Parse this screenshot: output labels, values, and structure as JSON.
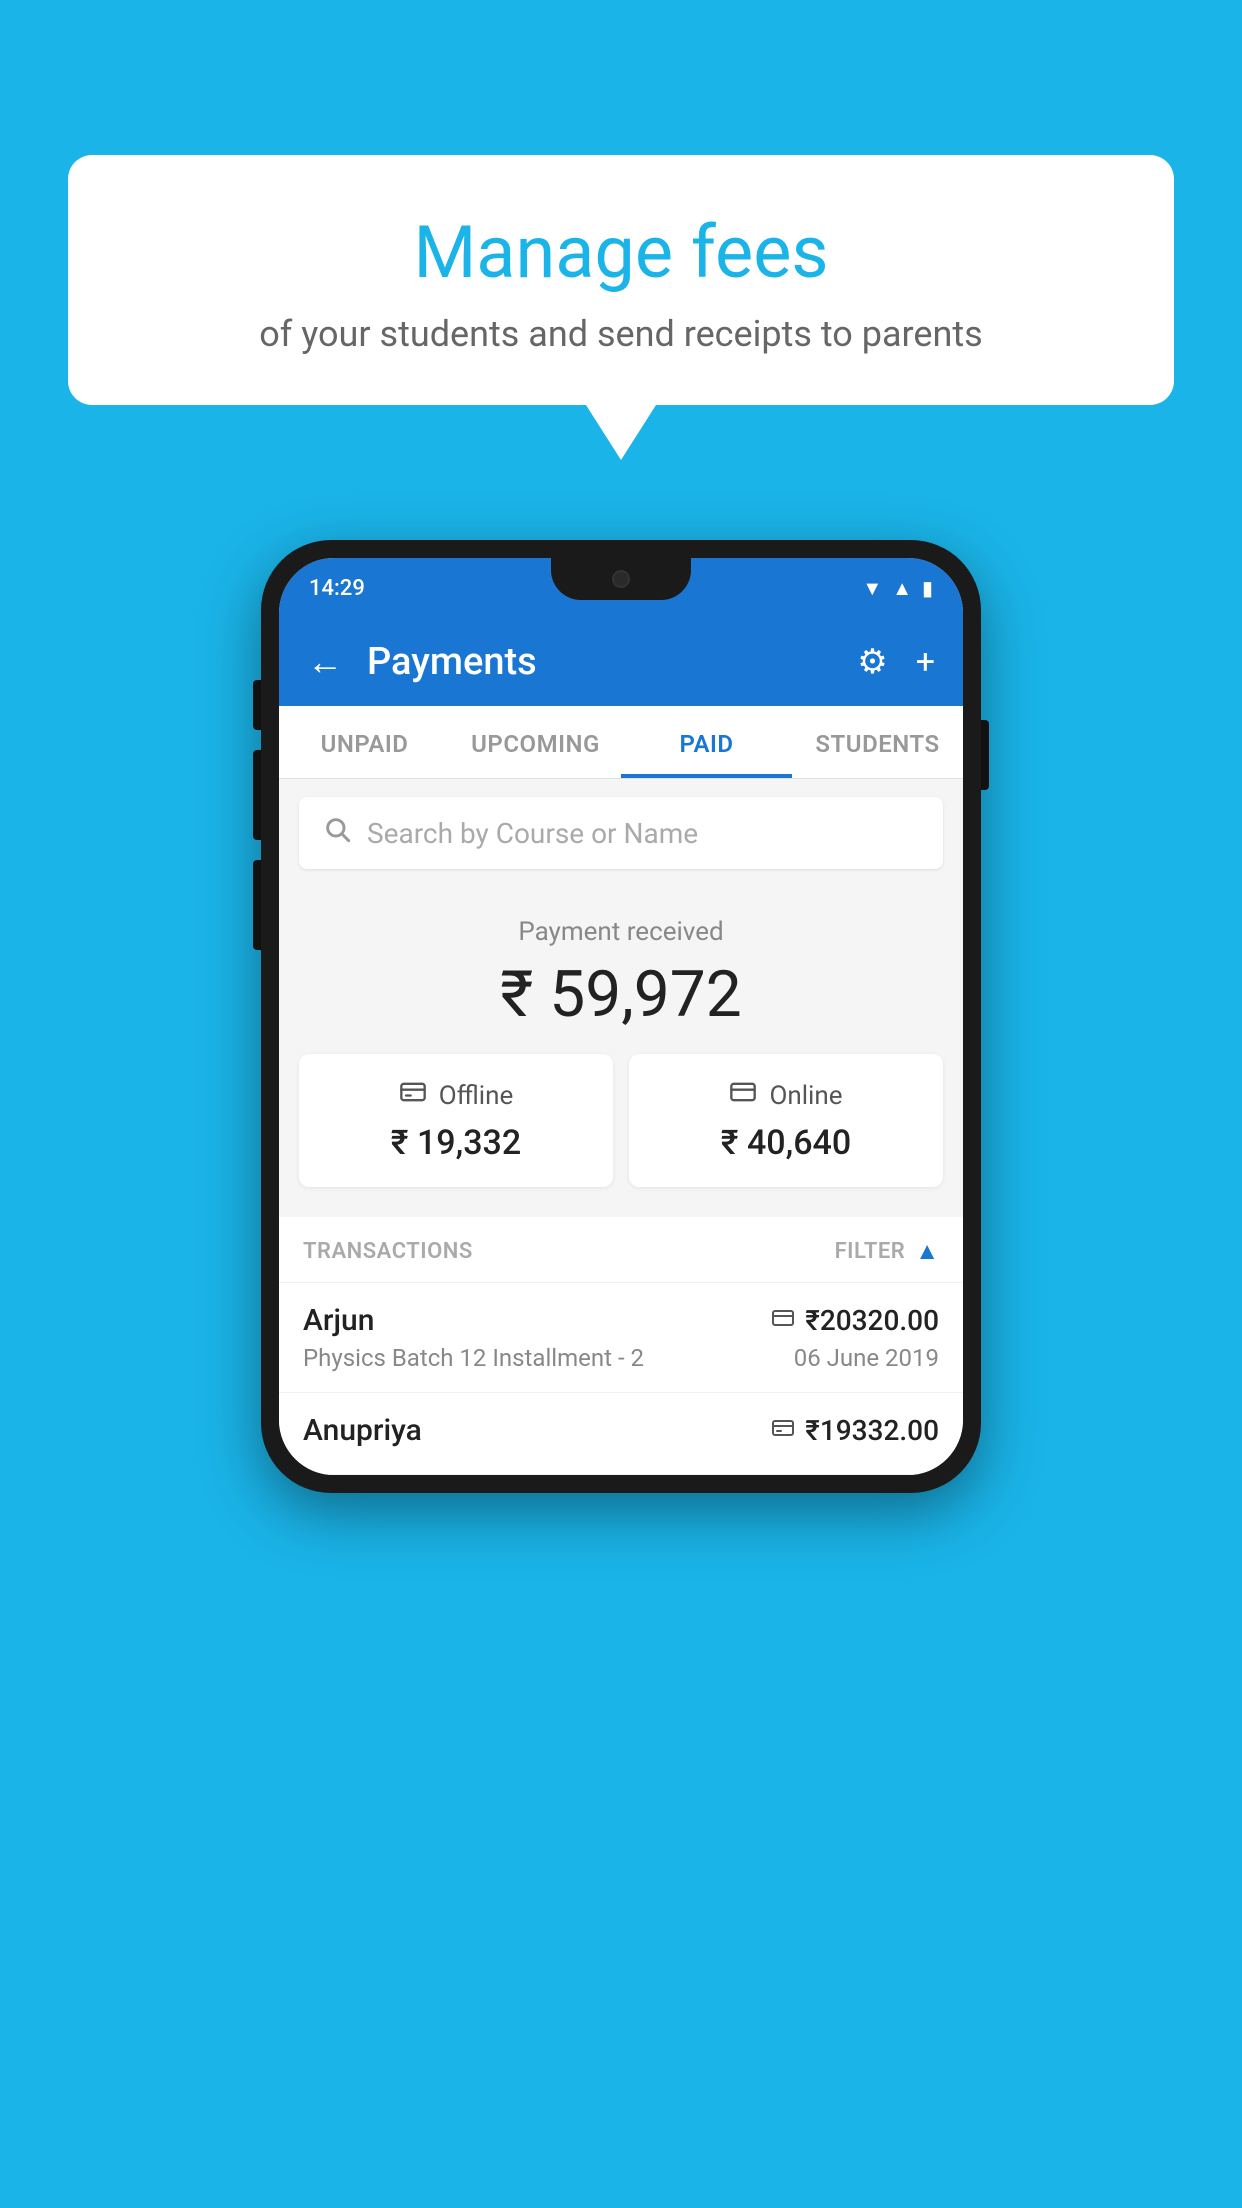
{
  "page": {
    "background_color": "#1ab4e8"
  },
  "speech_bubble": {
    "title": "Manage fees",
    "subtitle": "of your students and send receipts to parents"
  },
  "phone": {
    "status_bar": {
      "time": "14:29",
      "icons": [
        "wifi",
        "signal",
        "battery"
      ]
    },
    "app_bar": {
      "back_label": "←",
      "title": "Payments",
      "gear_label": "⚙",
      "plus_label": "+"
    },
    "tabs": [
      {
        "label": "UNPAID",
        "active": false
      },
      {
        "label": "UPCOMING",
        "active": false
      },
      {
        "label": "PAID",
        "active": true
      },
      {
        "label": "STUDENTS",
        "active": false
      }
    ],
    "search": {
      "placeholder": "Search by Course or Name",
      "icon": "🔍"
    },
    "payment_received": {
      "label": "Payment received",
      "amount": "₹ 59,972",
      "offline": {
        "icon": "💳",
        "label": "Offline",
        "amount": "₹ 19,332"
      },
      "online": {
        "icon": "💳",
        "label": "Online",
        "amount": "₹ 40,640"
      }
    },
    "transactions": {
      "header_label": "TRANSACTIONS",
      "filter_label": "FILTER",
      "items": [
        {
          "name": "Arjun",
          "payment_type": "online",
          "amount": "₹20320.00",
          "course": "Physics Batch 12 Installment - 2",
          "date": "06 June 2019"
        },
        {
          "name": "Anupriya",
          "payment_type": "offline",
          "amount": "₹19332.00",
          "course": "",
          "date": ""
        }
      ]
    }
  }
}
